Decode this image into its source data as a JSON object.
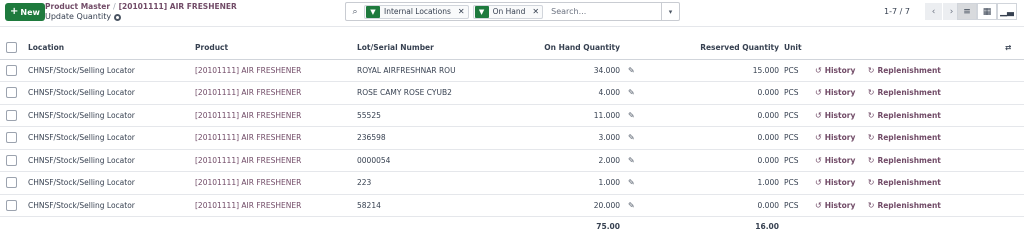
{
  "toolbar": {
    "new_label": "New",
    "breadcrumb_parent": "Product Master",
    "breadcrumb_current": "[20101111] AIR FRESHENER",
    "subtitle": "Update Quantity"
  },
  "search": {
    "facets": [
      {
        "label": "Internal Locations"
      },
      {
        "label": "On Hand"
      }
    ],
    "placeholder": "Search..."
  },
  "pager": {
    "range": "1-7 / 7"
  },
  "table": {
    "headers": {
      "location": "Location",
      "product": "Product",
      "lot": "Lot/Serial Number",
      "on_hand": "On Hand Quantity",
      "reserved": "Reserved Quantity",
      "unit": "Unit"
    },
    "actions": {
      "history": "History",
      "replenishment": "Replenishment"
    },
    "rows": [
      {
        "location": "CHNSF/Stock/Selling Locator",
        "product": "[20101111] AIR FRESHENER",
        "lot": "ROYAL AIRFRESHNAR ROU",
        "on_hand": "34.000",
        "reserved": "15.000",
        "unit": "PCS"
      },
      {
        "location": "CHNSF/Stock/Selling Locator",
        "product": "[20101111] AIR FRESHENER",
        "lot": "ROSE CAMY ROSE CYUB2",
        "on_hand": "4.000",
        "reserved": "0.000",
        "unit": "PCS"
      },
      {
        "location": "CHNSF/Stock/Selling Locator",
        "product": "[20101111] AIR FRESHENER",
        "lot": "55525",
        "on_hand": "11.000",
        "reserved": "0.000",
        "unit": "PCS"
      },
      {
        "location": "CHNSF/Stock/Selling Locator",
        "product": "[20101111] AIR FRESHENER",
        "lot": "236598",
        "on_hand": "3.000",
        "reserved": "0.000",
        "unit": "PCS"
      },
      {
        "location": "CHNSF/Stock/Selling Locator",
        "product": "[20101111] AIR FRESHENER",
        "lot": "0000054",
        "on_hand": "2.000",
        "reserved": "0.000",
        "unit": "PCS"
      },
      {
        "location": "CHNSF/Stock/Selling Locator",
        "product": "[20101111] AIR FRESHENER",
        "lot": "223",
        "on_hand": "1.000",
        "reserved": "1.000",
        "unit": "PCS"
      },
      {
        "location": "CHNSF/Stock/Selling Locator",
        "product": "[20101111] AIR FRESHENER",
        "lot": "58214",
        "on_hand": "20.000",
        "reserved": "0.000",
        "unit": "PCS"
      }
    ],
    "totals": {
      "on_hand": "75.00",
      "reserved": "16.00"
    }
  },
  "colors": {
    "brand": "#714b67",
    "primary_button": "#1e7a3d"
  }
}
